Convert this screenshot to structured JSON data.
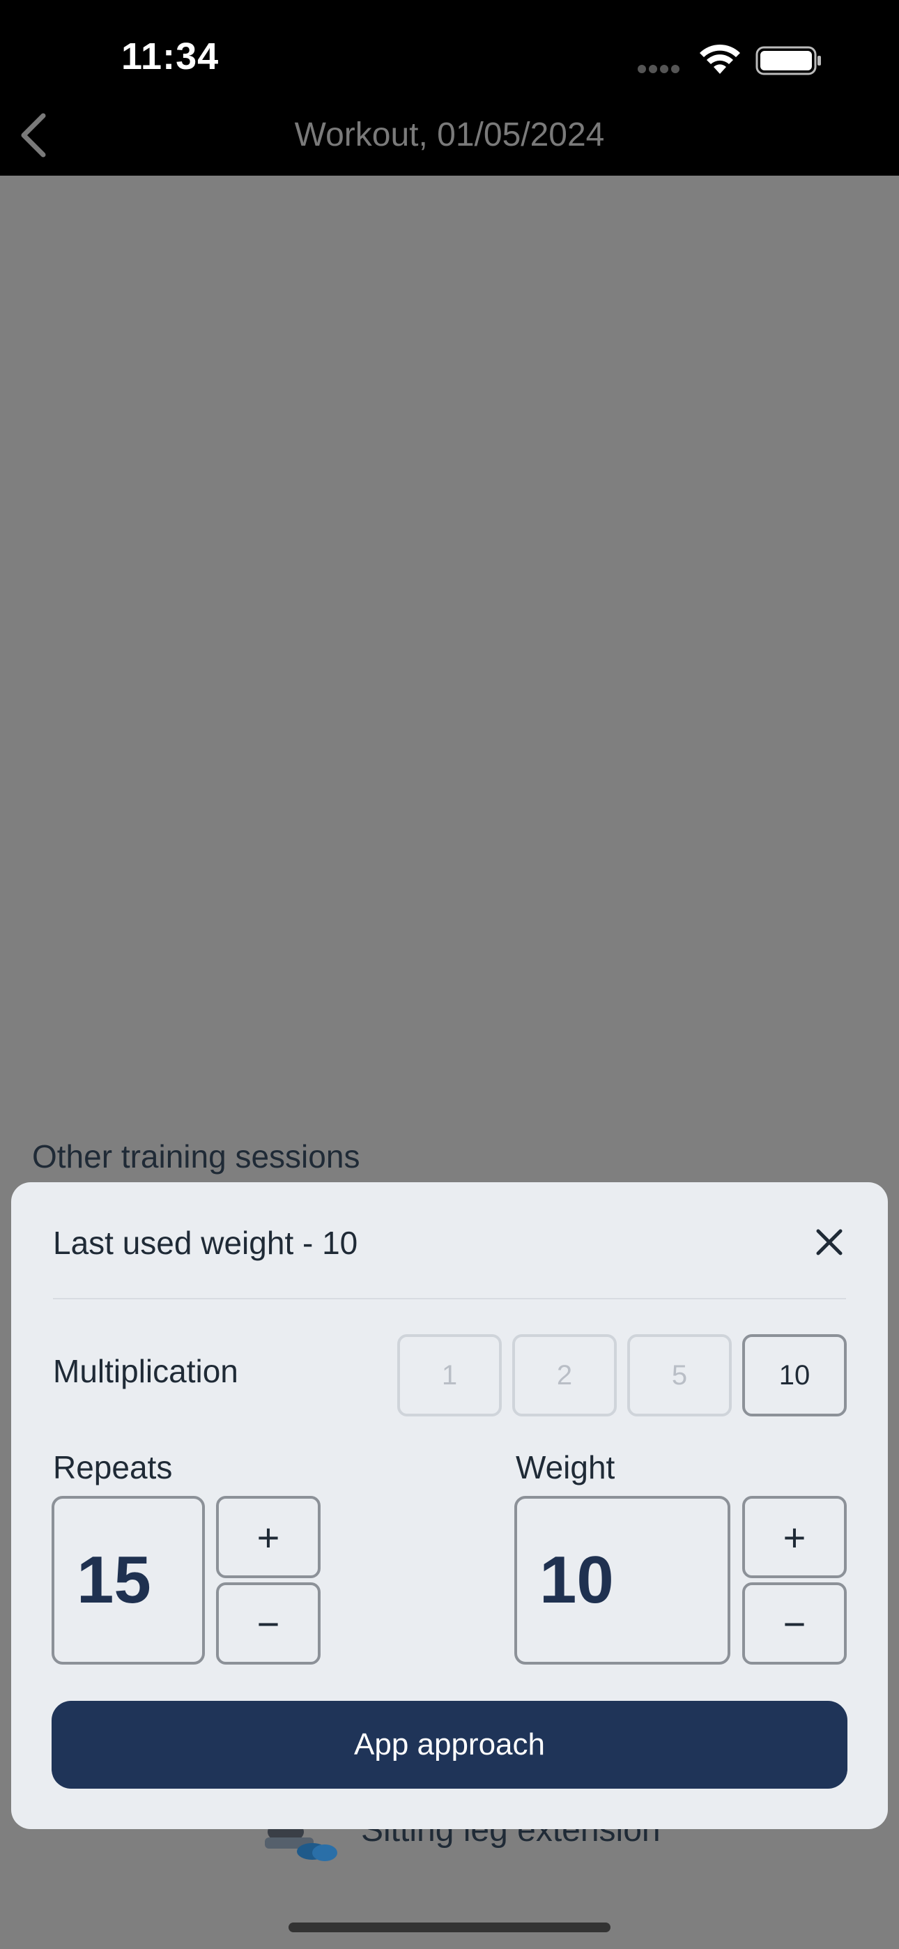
{
  "status_bar": {
    "time": "11:34"
  },
  "nav": {
    "title": "Workout, 01/05/2024"
  },
  "section": {
    "title": "Other training sessions"
  },
  "background_item": {
    "label": "Sitting leg extension"
  },
  "sheet": {
    "title": "Last used weight - 10",
    "multiplication_label": "Multiplication",
    "multiplication_options": [
      "1",
      "2",
      "5",
      "10"
    ],
    "multiplication_selected": "10",
    "repeats_label": "Repeats",
    "repeats_value": "15",
    "weight_label": "Weight",
    "weight_value": "10",
    "plus": "+",
    "minus": "−",
    "submit_label": "App approach"
  },
  "colors": {
    "primary": "#1f3458",
    "sheet_bg": "#eaedf1",
    "overlay": "#7f7f7f"
  }
}
